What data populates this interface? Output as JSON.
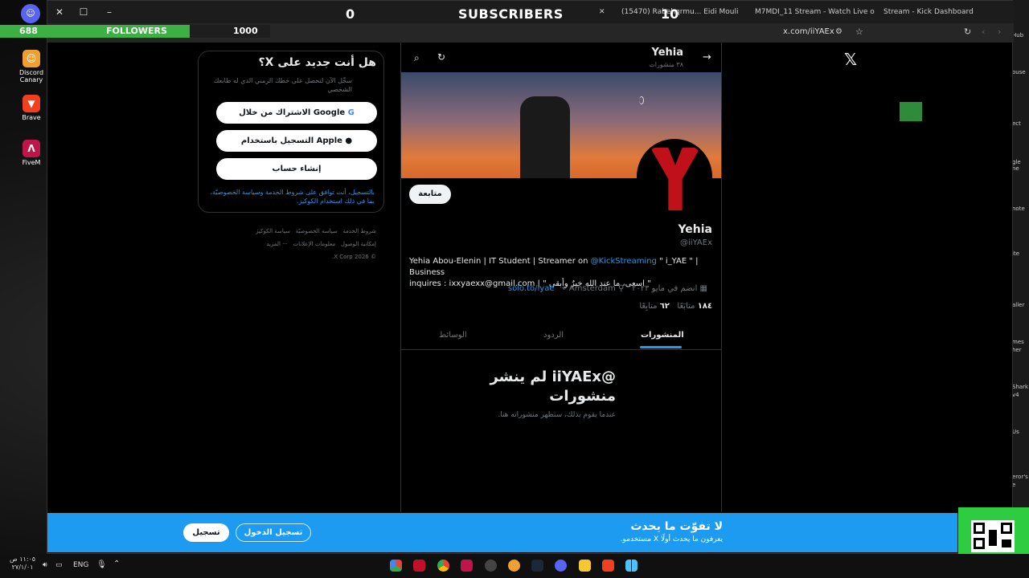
{
  "overlay": {
    "subscribers_count": "0",
    "subscribers_label": "SUBSCRIBERS",
    "subscribers_goal": "10",
    "followers_count": "688",
    "followers_label": "FOLLOWERS",
    "followers_goal": "1000"
  },
  "desktop_icons": [
    {
      "label": "Discord Canary",
      "color": "#f0a030"
    },
    {
      "label": "Brave",
      "color": "#f04020"
    },
    {
      "label": "FiveM",
      "color": "#c0154a"
    }
  ],
  "browser": {
    "tabs": [
      {
        "label": "(15470) Rabehqrmu... Eidi Mouli"
      },
      {
        "label": "M7MDI_11 Stream - Watch Live o"
      },
      {
        "label": "Stream - Kick Dashboard"
      }
    ],
    "url": "x.com/iiYAEx"
  },
  "login_card": {
    "title": "هل أنت جديد على X؟",
    "subtitle": "سجِّل الآن لتحصل على خطك الزمني الذي له طابعك الشخصي",
    "google_label": "الاشتراك من خلال Google",
    "apple_label": "التسجيل باستخدام Apple",
    "create_label": "إنشاء حساب",
    "terms_text": "بالتسجيل، أنت توافق على شروط الخدمة وسياسة الخصوصيّة، بما في ذلك استخدام الكوكيز."
  },
  "footer_links": [
    "شروط الخدمة",
    "سياسة الخصوصيّة",
    "سياسة الكوكيز",
    "إمكانية الوصول",
    "معلومات الإعلانات",
    "··· المزيد",
    "© 2026 X Corp."
  ],
  "profile": {
    "header_name": "Yehia",
    "header_posts": "٣٨ منشورات",
    "name": "Yehia",
    "handle": "@iiYAEx",
    "follow_label": "متابعة",
    "bio_line1_pre": "Yehia Abou-Elenin | IT Student | Streamer on ",
    "bio_mention": "@KickStreaming",
    "bio_line1_post": " \" i_YAE \" | Business",
    "bio_line2": "inquires : ixxyaexx@gmail.com | \" اسعى، ما عند الله خيرٌ وأبقى \"",
    "joined": "انضم في مايو ٢٠٢٣",
    "link": "solo.to/iyae",
    "location": "Amsterdam",
    "following_count": "١٨٤",
    "following_label": "متابَعًا",
    "followers_count": "٦٢",
    "followers_label": "متابِعًا",
    "tabs": [
      "المنشورات",
      "الردود",
      "الوسائط"
    ],
    "empty_title": "@iiYAEx لم ينشر منشورات",
    "empty_sub": "عندما يقوم بذلك، ستظهر منشوراته هنا."
  },
  "signup_bar": {
    "title": "لا تفوّت ما يحدث",
    "subtitle": "يعرفون ما يحدث أولًا X مستخدمو.",
    "login_label": "تسجيل الدخول",
    "signup_label": "تسجيل"
  },
  "taskbar": {
    "lang": "ENG",
    "time": "١١:٠٥ ص",
    "date": "٢٧/١/٠١"
  },
  "right_strip": [
    "Hub",
    "ouse",
    "ect",
    "gle",
    "ne",
    "note",
    "ite",
    "aller",
    "mes",
    "her",
    "Shark",
    "v4",
    "Us",
    "eror's",
    "e"
  ]
}
